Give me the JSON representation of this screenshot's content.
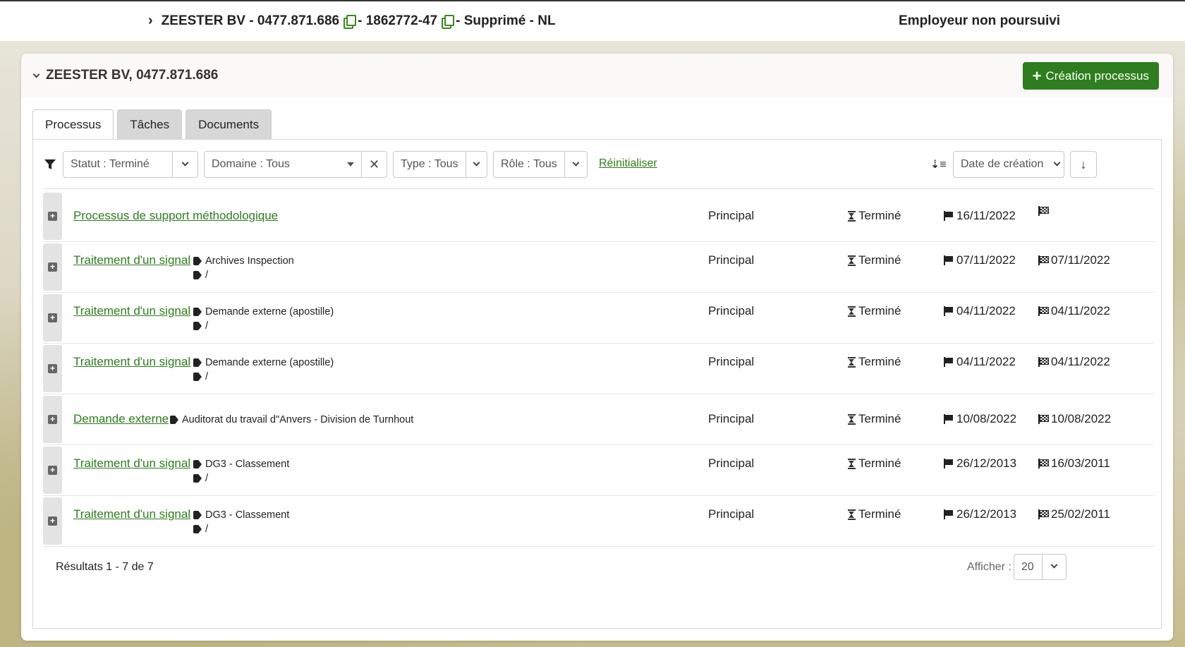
{
  "topbar": {
    "crumb_parts": [
      "ZEESTER BV - 0477.871.686",
      "- 1862772-47",
      "- Supprimé - NL"
    ],
    "right_status": "Employeur non poursuivi"
  },
  "panel": {
    "title": "ZEESTER BV, 0477.871.686",
    "create_button": "Création processus"
  },
  "tabs": [
    {
      "label": "Processus",
      "active": true
    },
    {
      "label": "Tâches",
      "active": false
    },
    {
      "label": "Documents",
      "active": false
    }
  ],
  "filters": {
    "status": "Statut : Terminé",
    "domain": "Domaine : Tous",
    "type": "Type : Tous",
    "role": "Rôle : Tous",
    "reset": "Réinitialiser",
    "sort": "Date de création"
  },
  "rows": [
    {
      "name": "Processus de support méthodologique",
      "tags": [],
      "role": "Principal",
      "status": "Terminé",
      "start": "16/11/2022",
      "end": ""
    },
    {
      "name": "Traitement d'un signal",
      "tags": [
        "Archives Inspection",
        "/"
      ],
      "role": "Principal",
      "status": "Terminé",
      "start": "07/11/2022",
      "end": "07/11/2022"
    },
    {
      "name": "Traitement d'un signal",
      "tags": [
        "Demande externe (apostille)",
        "/"
      ],
      "role": "Principal",
      "status": "Terminé",
      "start": "04/11/2022",
      "end": "04/11/2022"
    },
    {
      "name": "Traitement d'un signal",
      "tags": [
        "Demande externe (apostille)",
        "/"
      ],
      "role": "Principal",
      "status": "Terminé",
      "start": "04/11/2022",
      "end": "04/11/2022"
    },
    {
      "name": "Demande externe",
      "tags": [
        "Auditorat du travail d\"Anvers - Division de Turnhout"
      ],
      "role": "Principal",
      "status": "Terminé",
      "start": "10/08/2022",
      "end": "10/08/2022"
    },
    {
      "name": "Traitement d'un signal",
      "tags": [
        "DG3 - Classement",
        "/"
      ],
      "role": "Principal",
      "status": "Terminé",
      "start": "26/12/2013",
      "end": "16/03/2011"
    },
    {
      "name": "Traitement d'un signal",
      "tags": [
        "DG3 - Classement",
        "/"
      ],
      "role": "Principal",
      "status": "Terminé",
      "start": "26/12/2013",
      "end": "25/02/2011"
    }
  ],
  "footer": {
    "results": "Résultats 1 - 7 de 7",
    "show_label": "Afficher :",
    "page_size": "20"
  },
  "colors": {
    "accent": "#2e7d1e"
  }
}
